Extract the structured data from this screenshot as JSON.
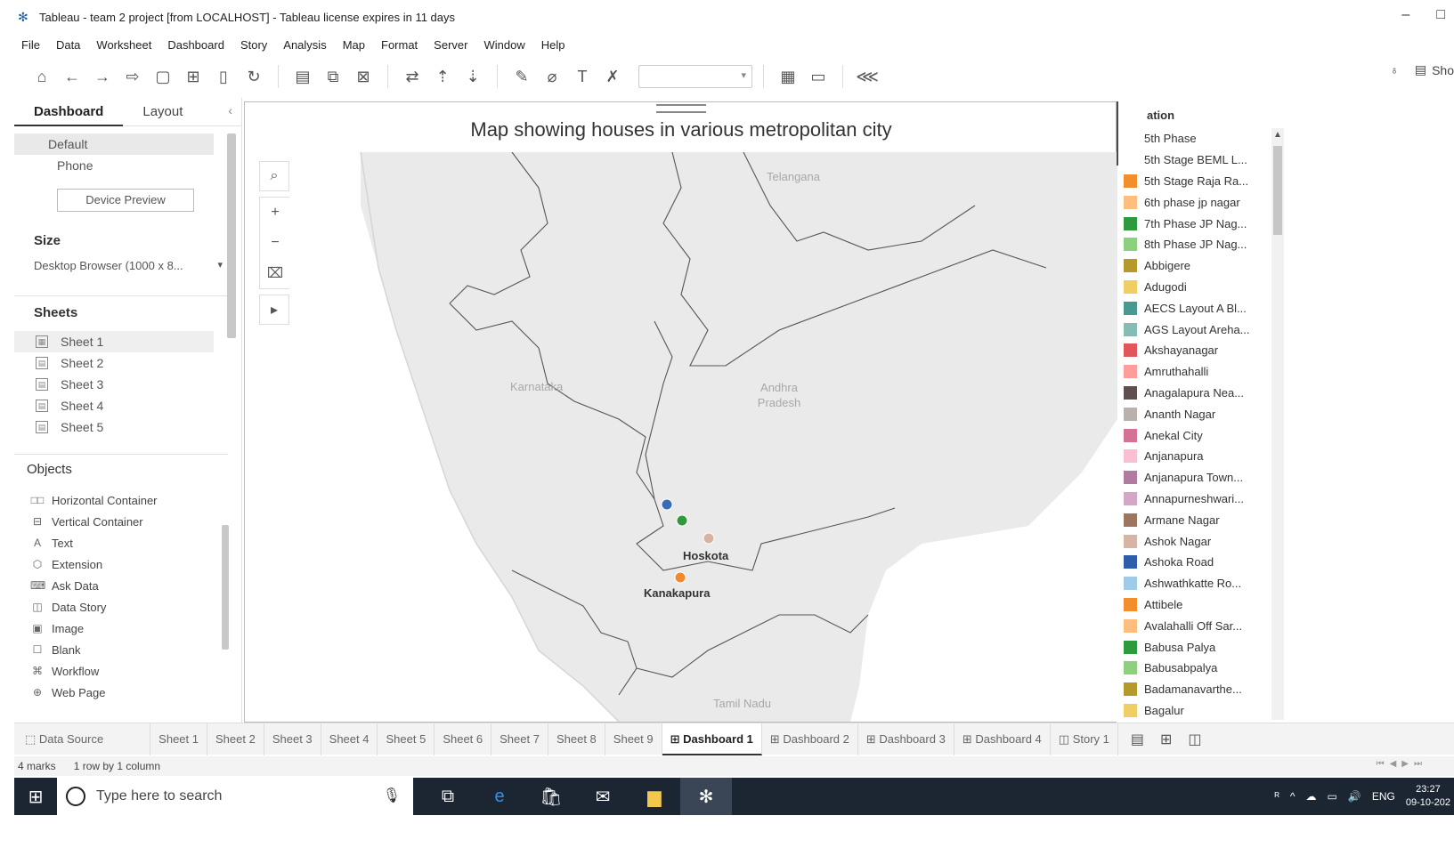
{
  "window": {
    "title": "Tableau - team 2 project [from LOCALHOST] - Tableau license expires in 11 days",
    "minimize": "–",
    "maximize": "□"
  },
  "menu": [
    "File",
    "Data",
    "Worksheet",
    "Dashboard",
    "Story",
    "Analysis",
    "Map",
    "Format",
    "Server",
    "Window",
    "Help"
  ],
  "toolbar": {
    "show_me_label": "Sho"
  },
  "left_panel": {
    "tabs": [
      "Dashboard",
      "Layout"
    ],
    "devices": [
      "Default",
      "Phone"
    ],
    "device_preview_label": "Device Preview",
    "size_heading": "Size",
    "size_value": "Desktop Browser (1000 x 8...",
    "sheets_heading": "Sheets",
    "sheets": [
      "Sheet 1",
      "Sheet 2",
      "Sheet 3",
      "Sheet 4",
      "Sheet 5"
    ],
    "objects_heading": "Objects",
    "objects": [
      {
        "label": "Horizontal Container",
        "icon": "□□"
      },
      {
        "label": "Vertical Container",
        "icon": "⊟"
      },
      {
        "label": "Text",
        "icon": "A"
      },
      {
        "label": "Extension",
        "icon": "⬡"
      },
      {
        "label": "Ask Data",
        "icon": "⌨"
      },
      {
        "label": "Data Story",
        "icon": "◫"
      },
      {
        "label": "Image",
        "icon": "▣"
      },
      {
        "label": "Blank",
        "icon": "☐"
      },
      {
        "label": "Workflow",
        "icon": "⌘"
      },
      {
        "label": "Web Page",
        "icon": "⊕"
      }
    ]
  },
  "dashboard": {
    "title": "Map showing houses in various metropolitan city",
    "regions": [
      "Telangana",
      "Karnataka",
      "Andhra Pradesh",
      "Tamil Nadu"
    ],
    "cities": [
      "Hoskota",
      "Kanakapura"
    ],
    "marks": [
      {
        "color": "#3a6bb5"
      },
      {
        "color": "#2f9a3d"
      },
      {
        "color": "#d9b3a0"
      },
      {
        "color": "#f08a2b"
      }
    ]
  },
  "legend": {
    "title": "ation",
    "items": [
      {
        "label": "5th Phase",
        "color": "#ffffff"
      },
      {
        "label": "5th Stage BEML L...",
        "color": "#ffffff"
      },
      {
        "label": "5th Stage Raja Ra...",
        "color": "#f28e2b"
      },
      {
        "label": "6th phase jp nagar",
        "color": "#ffbe7d"
      },
      {
        "label": "7th Phase JP Nag...",
        "color": "#2f9a3d"
      },
      {
        "label": "8th Phase JP Nag...",
        "color": "#8cd17d"
      },
      {
        "label": "Abbigere",
        "color": "#b6992d"
      },
      {
        "label": "Adugodi",
        "color": "#f1ce63"
      },
      {
        "label": "AECS Layout A Bl...",
        "color": "#499894"
      },
      {
        "label": "AGS Layout Areha...",
        "color": "#86bcb6"
      },
      {
        "label": "Akshayanagar",
        "color": "#e15759"
      },
      {
        "label": "Amruthahalli",
        "color": "#ff9d9a"
      },
      {
        "label": "Anagalapura Nea...",
        "color": "#5f5050"
      },
      {
        "label": "Ananth Nagar",
        "color": "#bab0ac"
      },
      {
        "label": "Anekal City",
        "color": "#d37295"
      },
      {
        "label": "Anjanapura",
        "color": "#fabfd2"
      },
      {
        "label": "Anjanapura Town...",
        "color": "#b07aa1"
      },
      {
        "label": "Annapurneshwari...",
        "color": "#d4a6c8"
      },
      {
        "label": "Armane Nagar",
        "color": "#9d7660"
      },
      {
        "label": "Ashok Nagar",
        "color": "#d7b5a6"
      },
      {
        "label": "Ashoka Road",
        "color": "#2f5ea8"
      },
      {
        "label": "Ashwathkatte Ro...",
        "color": "#a0cbe8"
      },
      {
        "label": "Attibele",
        "color": "#f28e2b"
      },
      {
        "label": "Avalahalli Off Sar...",
        "color": "#ffbe7d"
      },
      {
        "label": "Babusa Palya",
        "color": "#2f9a3d"
      },
      {
        "label": "Babusabpalya",
        "color": "#8cd17d"
      },
      {
        "label": "Badamanavarthe...",
        "color": "#b6992d"
      },
      {
        "label": "Bagalur",
        "color": "#f1ce63"
      }
    ]
  },
  "sheet_tabs": {
    "data_source": "Data Source",
    "tabs": [
      "Sheet 1",
      "Sheet 2",
      "Sheet 3",
      "Sheet 4",
      "Sheet 5",
      "Sheet 6",
      "Sheet 7",
      "Sheet 8",
      "Sheet 9",
      "Dashboard 1",
      "Dashboard 2",
      "Dashboard 3",
      "Dashboard 4",
      "Story 1"
    ],
    "active": "Dashboard 1"
  },
  "status": {
    "marks": "4 marks",
    "rows": "1 row by 1 column"
  },
  "taskbar": {
    "search_placeholder": "Type here to search",
    "language": "ENG",
    "time": "23:27",
    "date": "09-10-202"
  }
}
